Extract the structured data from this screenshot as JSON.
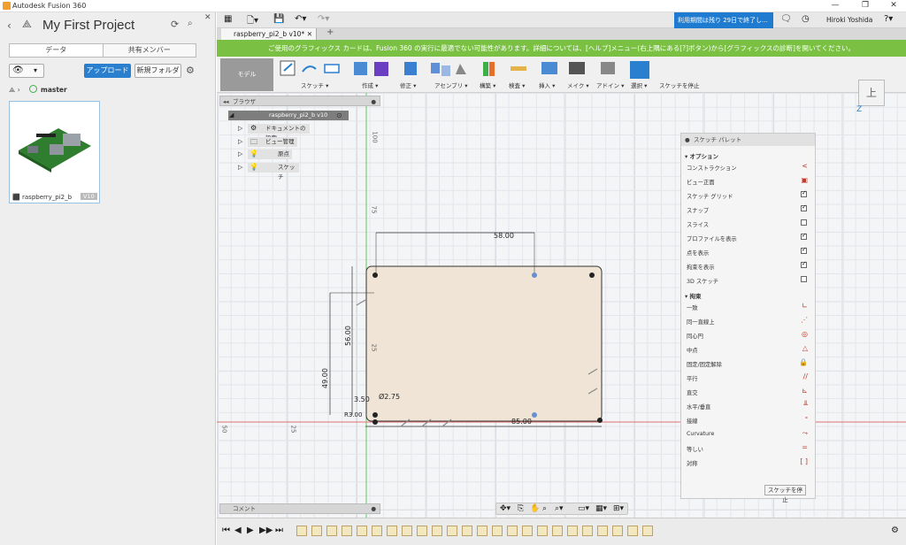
{
  "app": {
    "window_title": "Autodesk Fusion 360",
    "user": "Hiroki Yoshida",
    "trial_notice": "利用期間は残り 29日で終了し..."
  },
  "data_panel": {
    "project_title": "My First Project",
    "tabs": [
      {
        "label": "データ"
      },
      {
        "label": "共有メンバー"
      }
    ],
    "upload_label": "アップロード",
    "new_folder_label": "新規フォルダ",
    "branch": "master",
    "file": {
      "name": "raspberry_pi2_b",
      "version": "V10"
    }
  },
  "doc_tab": {
    "label": "raspberry_pi2_b v10*"
  },
  "banner": "ご使用のグラフィックス カードは、Fusion 360 の実行に最適でない可能性があります。詳細については、[ヘルプ]メニュー(右上隅にある[?]ボタン)から[グラフィックスの診断]を開いてください。",
  "ribbon": {
    "mode": "モデル",
    "groups": [
      {
        "label": "スケッチ ▾"
      },
      {
        "label": "作成 ▾"
      },
      {
        "label": "修正 ▾"
      },
      {
        "label": "アセンブリ ▾"
      },
      {
        "label": "構築 ▾"
      },
      {
        "label": "検査 ▾"
      },
      {
        "label": "挿入 ▾"
      },
      {
        "label": "メイク ▾"
      },
      {
        "label": "アドイン ▾"
      },
      {
        "label": "選択 ▾"
      },
      {
        "label": "スケッチを停止"
      }
    ]
  },
  "browser": {
    "title": "ブラウザ",
    "root": "raspberry_pi2_b v10",
    "items": [
      {
        "label": "ドキュメントの設定"
      },
      {
        "label": "ビュー管理"
      },
      {
        "label": "原点"
      },
      {
        "label": "スケッチ"
      }
    ]
  },
  "sketch": {
    "dimensions": {
      "width": "58.00",
      "length": "85.00",
      "height_outer": "56.00",
      "height_inner": "49.00",
      "offset": "3.50",
      "hole": "Ø2.75",
      "radius": "R3.00"
    },
    "ruler": {
      "v100": "100",
      "v75": "75",
      "v25": "25",
      "h50": "50",
      "h25": "25"
    }
  },
  "palette": {
    "title": "スケッチ パレット",
    "options_header": "▾ オプション",
    "options": [
      {
        "label": "コンストラクション",
        "kind": "glyph",
        "glyph": "<"
      },
      {
        "label": "ビュー正面",
        "kind": "glyph",
        "glyph": "▣"
      },
      {
        "label": "スケッチ グリッド",
        "kind": "check",
        "on": true
      },
      {
        "label": "スナップ",
        "kind": "check",
        "on": true
      },
      {
        "label": "スライス",
        "kind": "check",
        "on": false
      },
      {
        "label": "プロファイルを表示",
        "kind": "check",
        "on": true
      },
      {
        "label": "点を表示",
        "kind": "check",
        "on": true
      },
      {
        "label": "拘束を表示",
        "kind": "check",
        "on": true
      },
      {
        "label": "3D スケッチ",
        "kind": "check",
        "on": false
      }
    ],
    "constraints_header": "▾ 拘束",
    "constraints": [
      {
        "label": "一致",
        "glyph": "∟"
      },
      {
        "label": "同一直線上",
        "glyph": "⋰"
      },
      {
        "label": "同心円",
        "glyph": "◎"
      },
      {
        "label": "中点",
        "glyph": "△"
      },
      {
        "label": "固定/固定解除",
        "glyph": "🔒"
      },
      {
        "label": "平行",
        "glyph": "//"
      },
      {
        "label": "直交",
        "glyph": "⊾"
      },
      {
        "label": "水平/垂直",
        "glyph": "╨"
      },
      {
        "label": "接線",
        "glyph": "ᐤ"
      },
      {
        "label": "Curvature",
        "glyph": "⤳"
      },
      {
        "label": "等しい",
        "glyph": "="
      },
      {
        "label": "対称",
        "glyph": "[ ]"
      }
    ],
    "stop_label": "スケッチを停止"
  },
  "comment_label": "コメント",
  "viewcube_label": "上",
  "axis_z": "Z"
}
